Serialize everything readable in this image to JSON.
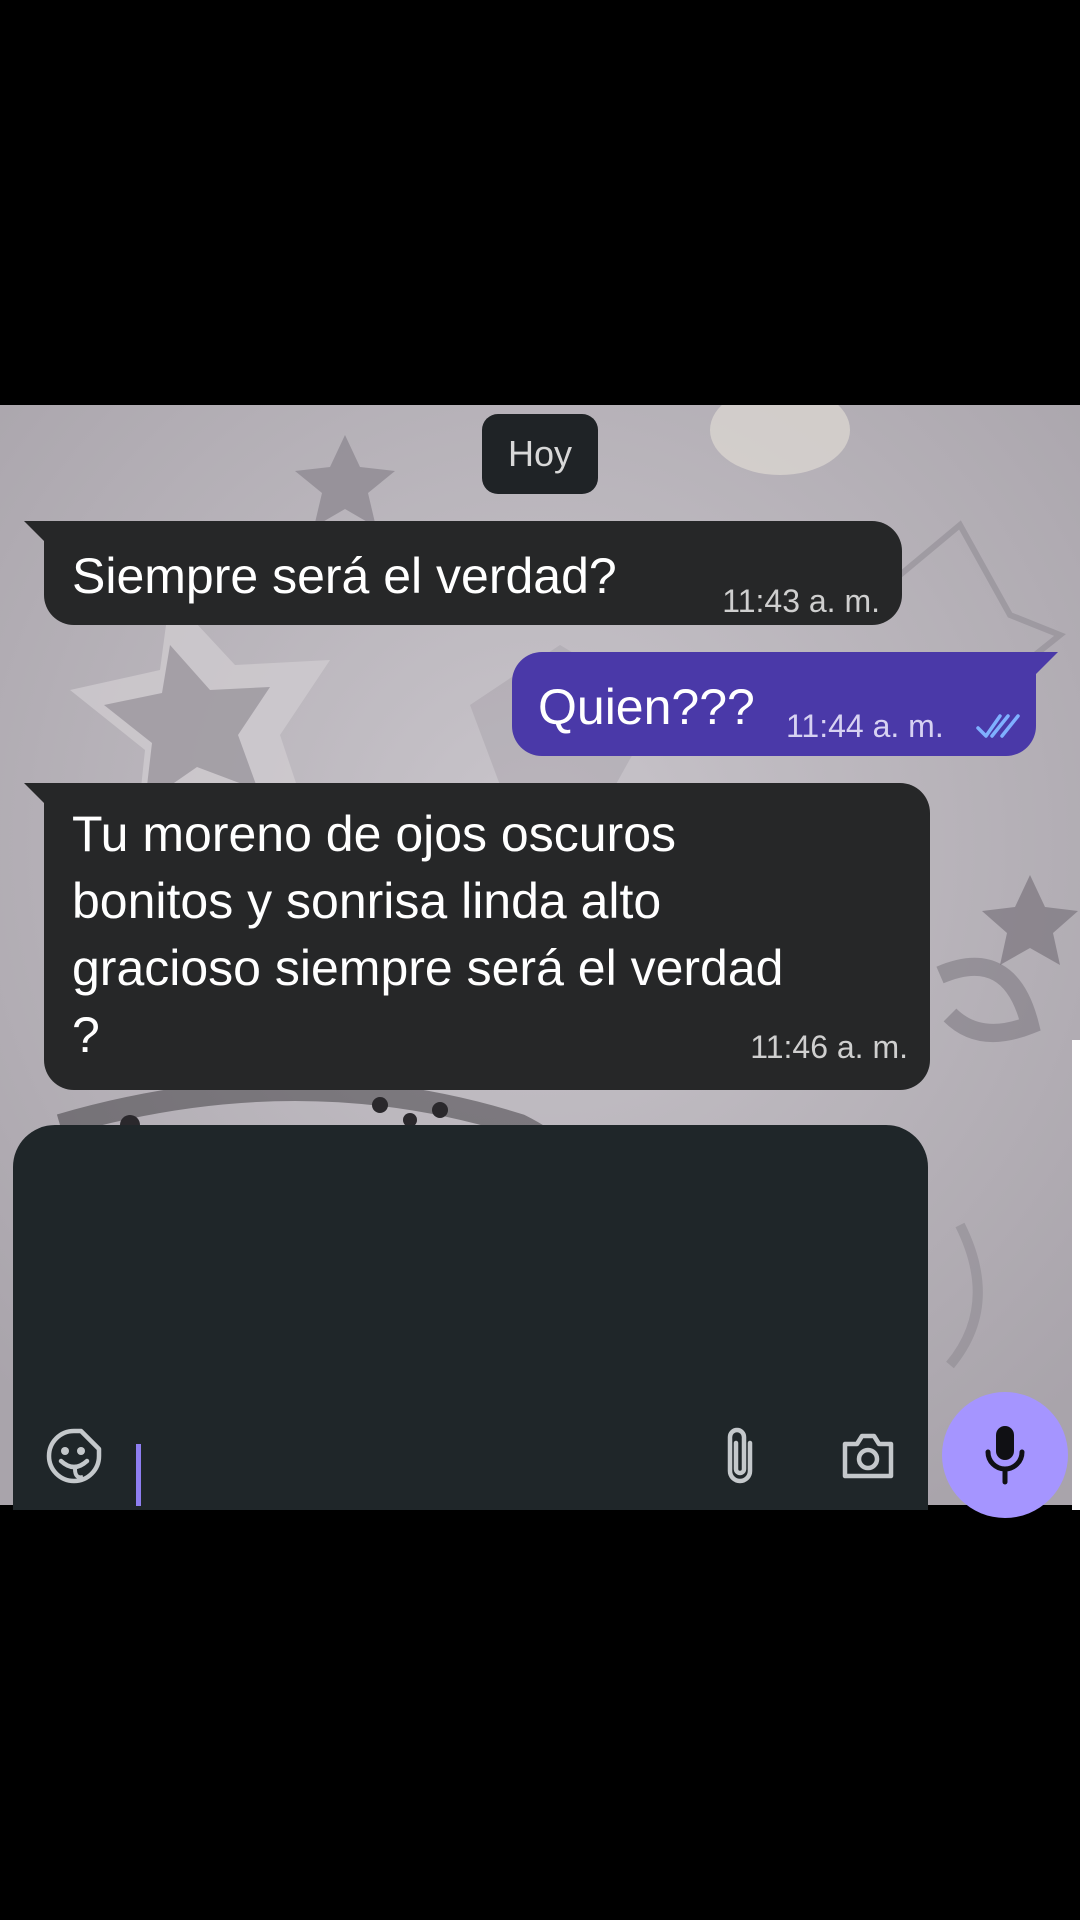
{
  "date_separator": "Hoy",
  "messages": [
    {
      "direction": "incoming",
      "text": "Siempre será el verdad?",
      "time": "11:43 a. m."
    },
    {
      "direction": "outgoing",
      "text": "Quien???",
      "time": "11:44 a. m.",
      "status_icon": "double-check-icon"
    },
    {
      "direction": "incoming",
      "text": "Tu moreno de ojos oscuros bonitos y sonrisa linda alto gracioso siempre será el verdad ?",
      "time": "11:46 a. m."
    }
  ],
  "composer": {
    "icons": [
      "sticker-emoji-icon",
      "paperclip-icon",
      "camera-icon"
    ],
    "send_icon": "microphone-icon"
  },
  "colors": {
    "incoming_bubble": "#262728",
    "outgoing_bubble": "#4a39a8",
    "composer_background": "#1f2629",
    "mic_button": "#a595ff",
    "read_receipt": "#7fb0ff"
  }
}
